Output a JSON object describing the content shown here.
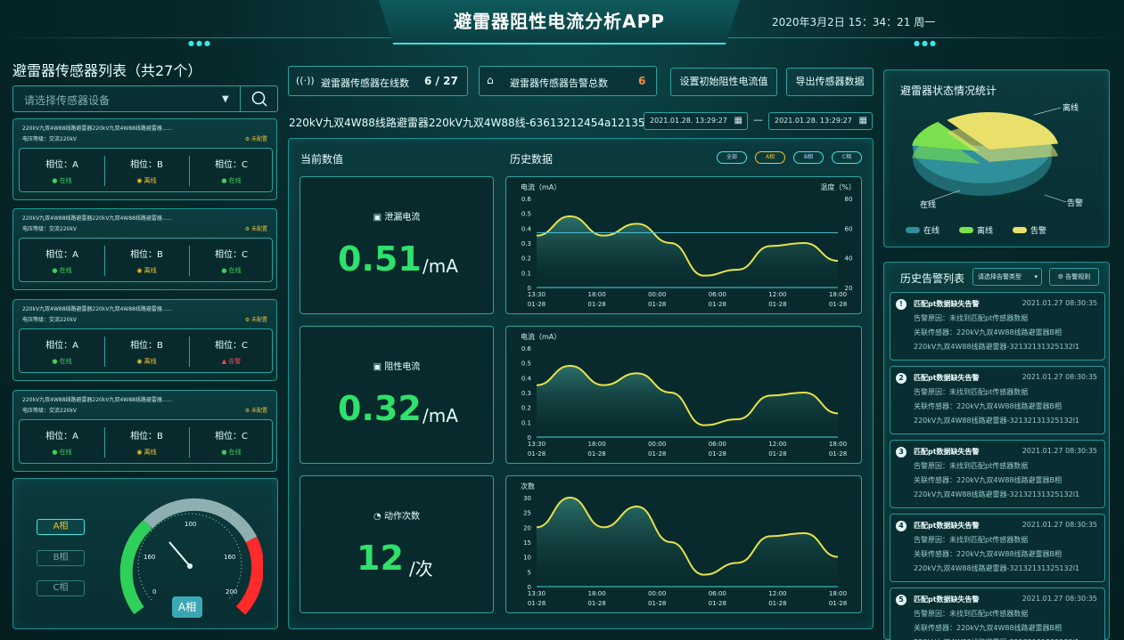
{
  "header": {
    "title": "避雷器阻性电流分析APP",
    "datetime": "2020年3月2日   15：34：21   周一"
  },
  "left": {
    "title": "避雷器传感器列表（共27个）",
    "search_placeholder": "请选择传感器设备",
    "cards": [
      {
        "name": "220kV九双4W88线路避雷器220kV九双4W88线路避雷器......",
        "voltage": "电压等级：交流220kV",
        "config": "未配置",
        "phases": [
          {
            "label": "相位：A",
            "state": "在线"
          },
          {
            "label": "相位：B",
            "state": "离线"
          },
          {
            "label": "相位：C",
            "state": "在线"
          }
        ]
      },
      {
        "name": "220kV九双4W88线路避雷器220kV九双4W88线路避雷器......",
        "voltage": "电压等级：交流220kV",
        "config": "未配置",
        "phases": [
          {
            "label": "相位：A",
            "state": "在线"
          },
          {
            "label": "相位：B",
            "state": "离线"
          },
          {
            "label": "相位：C",
            "state": "在线"
          }
        ]
      },
      {
        "name": "220kV九双4W88线路避雷器220kV九双4W88线路避雷器......",
        "voltage": "电压等级：交流220kV",
        "config": "未配置",
        "phases": [
          {
            "label": "相位：A",
            "state": "在线"
          },
          {
            "label": "相位：B",
            "state": "离线"
          },
          {
            "label": "相位：C",
            "state": "告警"
          }
        ]
      },
      {
        "name": "220kV九双4W88线路避雷器220kV九双4W88线路避雷器......",
        "voltage": "电压等级：交流220kV",
        "config": "未配置",
        "phases": [
          {
            "label": "相位：A",
            "state": "在线"
          },
          {
            "label": "相位：B",
            "state": "离线"
          },
          {
            "label": "相位：C",
            "state": "在线"
          }
        ]
      }
    ],
    "gauge": {
      "phase_buttons": [
        "A相",
        "B相",
        "C相"
      ],
      "active": "A相",
      "label": "A相",
      "ticks": [
        "0",
        "160",
        "100",
        "160",
        "200"
      ]
    }
  },
  "top": {
    "online_label": "避雷器传感器在线数",
    "online_value": "6 / 27",
    "alarm_label": "避雷器传感器告警总数",
    "alarm_value": "6",
    "btn_set": "设置初始阻性电流值",
    "btn_export": "导出传感器数据",
    "device": "220kV九双4W88线路避雷器220kV九双4W88线-63613212454a12135",
    "date_from": "2021.01.28.  13:29:27",
    "date_to": "2021.01.28.  13:29:27",
    "dash": "—"
  },
  "main": {
    "current_label": "当前数值",
    "history_label": "历史数据",
    "filters": [
      "全部",
      "A相",
      "B相",
      "C相"
    ],
    "active_filter": "A相",
    "values": [
      {
        "name": "泄漏电流",
        "num": "0.51",
        "unit": "/mA"
      },
      {
        "name": "阻性电流",
        "num": "0.32",
        "unit": "/mA"
      },
      {
        "name": "动作次数",
        "num": "12",
        "unit": "/次"
      }
    ]
  },
  "chart_data": [
    {
      "type": "line",
      "ylabel": "电流（mA）",
      "y2label": "温度（%）",
      "ylim": [
        0,
        0.6
      ],
      "y2lim": [
        20,
        80
      ],
      "yticks": [
        "0.6",
        "0.5",
        "0.4",
        "0.3",
        "0.2",
        "0.1",
        "0"
      ],
      "y2ticks": [
        "80",
        "60",
        "40",
        "20"
      ],
      "x": [
        "13:30\n01-28",
        "18:00\n01-28",
        "00:00\n01-28",
        "06:00\n01-28",
        "12:00\n01-28",
        "18:00\n01-28"
      ],
      "series": [
        {
          "values": [
            0.35,
            0.48,
            0.35,
            0.43,
            0.3,
            0.08,
            0.12,
            0.28,
            0.3,
            0.18
          ]
        },
        {
          "values": [
            0.37,
            0.37,
            0.37,
            0.37,
            0.37,
            0.37,
            0.37,
            0.37,
            0.37,
            0.37
          ]
        }
      ]
    },
    {
      "type": "area",
      "ylabel": "电流（mA）",
      "ylim": [
        0,
        0.6
      ],
      "yticks": [
        "0.6",
        "0.5",
        "0.4",
        "0.3",
        "0.2",
        "0.1",
        "0"
      ],
      "x": [
        "13:30\n01-28",
        "18:00\n01-28",
        "00:00\n01-28",
        "06:00\n01-28",
        "12:00\n01-28",
        "18:00\n01-28"
      ],
      "series": [
        {
          "values": [
            0.35,
            0.48,
            0.35,
            0.43,
            0.3,
            0.08,
            0.12,
            0.28,
            0.3,
            0.16
          ]
        }
      ]
    },
    {
      "type": "area",
      "ylabel": "次数",
      "ylim": [
        0,
        30
      ],
      "yticks": [
        "30",
        "25",
        "20",
        "15",
        "10",
        "5",
        "0"
      ],
      "x": [
        "13:30\n01-28",
        "18:00\n01-28",
        "00:00\n01-28",
        "06:00\n01-28",
        "12:00\n01-28",
        "18:00\n01-28"
      ],
      "series": [
        {
          "values": [
            20,
            30,
            20,
            27,
            15,
            4,
            8,
            17,
            18,
            10
          ]
        }
      ]
    },
    {
      "type": "pie",
      "title": "避雷器状态情况统计",
      "categories": [
        "在线",
        "离线",
        "告警"
      ],
      "values": [
        55,
        12,
        33
      ],
      "colors": [
        "#2f8f9a",
        "#7be04d",
        "#e8e06a"
      ],
      "labels": [
        "离线",
        "在线",
        "告警"
      ]
    }
  ],
  "right": {
    "alarm_title": "历史告警列表",
    "alarm_select": "请选择告警类型",
    "alarm_rule": "告警规则",
    "alarms": [
      {
        "icon": "!",
        "title": "匹配pt数据缺失告警",
        "time": "2021.01.27 08:30:35",
        "reason": "告警原因：未找到匹配pt传感器数据",
        "rel": "关联传感器：220kV九双4W88线路避雷器B相",
        "id": "220kV九双4W88线路避雷器-32132131325132l1"
      },
      {
        "icon": "2",
        "title": "匹配pt数据缺失告警",
        "time": "2021.01.27 08:30:35",
        "reason": "告警原因：未找到匹配pt传感器数据",
        "rel": "关联传感器：220kV九双4W88线路避雷器B相",
        "id": "220kV九双4W88线路避雷器-32132131325132l1"
      },
      {
        "icon": "3",
        "title": "匹配pt数据缺失告警",
        "time": "2021.01.27 08:30:35",
        "reason": "告警原因：未找到匹配pt传感器数据",
        "rel": "关联传感器：220kV九双4W88线路避雷器B相",
        "id": "220kV九双4W88线路避雷器-32132131325132l1"
      },
      {
        "icon": "4",
        "title": "匹配pt数据缺失告警",
        "time": "2021.01.27 08:30:35",
        "reason": "告警原因：未找到匹配pt传感器数据",
        "rel": "关联传感器：220kV九双4W88线路避雷器B相",
        "id": "220kV九双4W88线路避雷器-32132131325132l1"
      },
      {
        "icon": "5",
        "title": "匹配pt数据缺失告警",
        "time": "2021.01.27 08:30:35",
        "reason": "告警原因：未找到匹配pt传感器数据",
        "rel": "关联传感器：220kV九双4W88线路避雷器B相",
        "id": "220kV九双4W88线路避雷器-32132131325132l1"
      }
    ]
  }
}
